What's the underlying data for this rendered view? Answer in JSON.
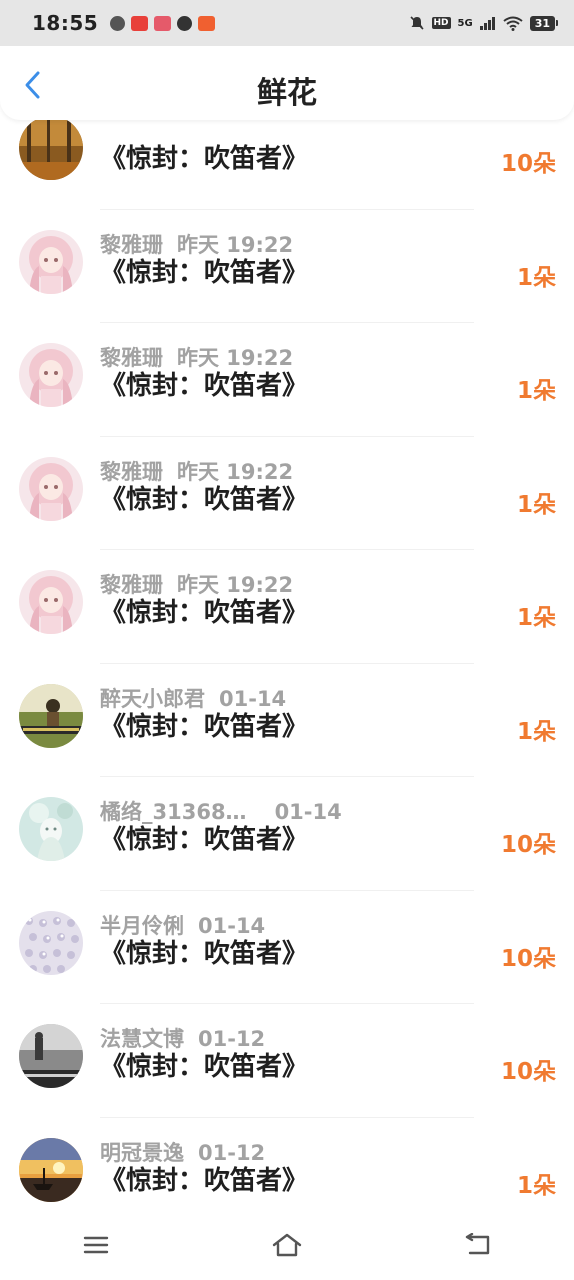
{
  "status_bar": {
    "time": "18:55",
    "network": "5G",
    "battery": "31"
  },
  "header": {
    "title": "鲜花",
    "back_icon": "chevron-left-icon"
  },
  "colors": {
    "accent_blue": "#3c8ee8",
    "amount_orange": "#f07a30",
    "name_gray": "#a2a2a2",
    "title_black": "#1f1f1f"
  },
  "items": [
    {
      "name": "",
      "time": "",
      "book": "《惊封：吹笛者》",
      "amount": "10朵",
      "avatar": "autumn-forest"
    },
    {
      "name": "黎雅珊",
      "time": "昨天 19:22",
      "book": "《惊封：吹笛者》",
      "amount": "1朵",
      "avatar": "pink-anime-girl"
    },
    {
      "name": "黎雅珊",
      "time": "昨天 19:22",
      "book": "《惊封：吹笛者》",
      "amount": "1朵",
      "avatar": "pink-anime-girl"
    },
    {
      "name": "黎雅珊",
      "time": "昨天 19:22",
      "book": "《惊封：吹笛者》",
      "amount": "1朵",
      "avatar": "pink-anime-girl"
    },
    {
      "name": "黎雅珊",
      "time": "昨天 19:22",
      "book": "《惊封：吹笛者》",
      "amount": "1朵",
      "avatar": "pink-anime-girl"
    },
    {
      "name": "醉天小郎君",
      "time": "01-14",
      "book": "《惊封：吹笛者》",
      "amount": "1朵",
      "avatar": "field-landscape"
    },
    {
      "name": "橘络_31368…",
      "time": "01-14",
      "book": "《惊封：吹笛者》",
      "amount": "10朵",
      "avatar": "green-fairy"
    },
    {
      "name": "半月伶俐",
      "time": "01-14",
      "book": "《惊封：吹笛者》",
      "amount": "10朵",
      "avatar": "crystal-pattern"
    },
    {
      "name": "法慧文博",
      "time": "01-12",
      "book": "《惊封：吹笛者》",
      "amount": "10朵",
      "avatar": "bw-seaside"
    },
    {
      "name": "明冠景逸",
      "time": "01-12",
      "book": "《惊封：吹笛者》",
      "amount": "1朵",
      "avatar": "sunset-boat"
    }
  ],
  "nav": {
    "menu_icon": "menu-icon",
    "home_icon": "home-icon",
    "back_icon": "back-icon"
  }
}
